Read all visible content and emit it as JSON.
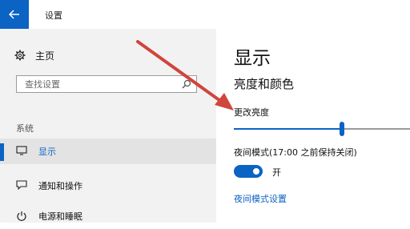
{
  "window": {
    "title": "设置",
    "back_icon": "back-arrow-icon"
  },
  "sidebar": {
    "home_label": "主页",
    "search_placeholder": "查找设置",
    "section_label": "系统",
    "items": [
      {
        "label": "显示",
        "icon": "monitor-icon",
        "active": true
      },
      {
        "label": "通知和操作",
        "icon": "notification-icon",
        "active": false
      },
      {
        "label": "电源和睡眠",
        "icon": "power-icon",
        "active": false
      }
    ]
  },
  "main": {
    "page_title": "显示",
    "section_title": "亮度和颜色",
    "brightness_label": "更改亮度",
    "brightness_value": 0.6,
    "night_light_label": "夜间模式(17:00 之前保持关闭)",
    "night_light_state": "开",
    "night_light_link": "夜间模式设置"
  },
  "colors": {
    "accent": "#0b63c4",
    "annotation_arrow": "#d0453c"
  }
}
